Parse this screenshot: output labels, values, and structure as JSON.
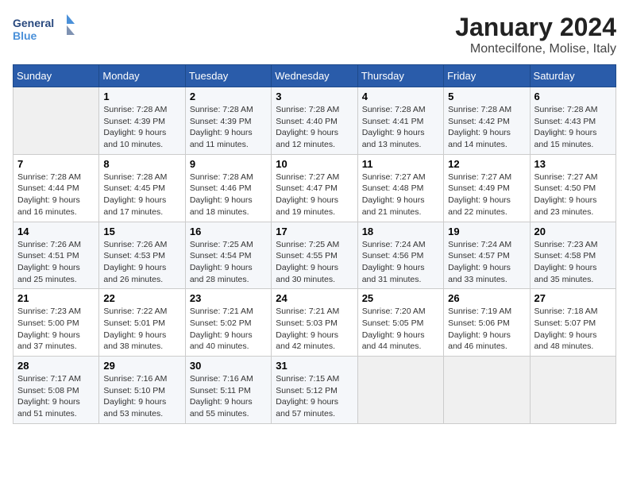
{
  "header": {
    "logo_line1": "General",
    "logo_line2": "Blue",
    "month": "January 2024",
    "location": "Montecilfone, Molise, Italy"
  },
  "days_of_week": [
    "Sunday",
    "Monday",
    "Tuesday",
    "Wednesday",
    "Thursday",
    "Friday",
    "Saturday"
  ],
  "weeks": [
    [
      {
        "num": "",
        "empty": true
      },
      {
        "num": "1",
        "sunrise": "7:28 AM",
        "sunset": "4:39 PM",
        "daylight": "9 hours and 10 minutes."
      },
      {
        "num": "2",
        "sunrise": "7:28 AM",
        "sunset": "4:39 PM",
        "daylight": "9 hours and 11 minutes."
      },
      {
        "num": "3",
        "sunrise": "7:28 AM",
        "sunset": "4:40 PM",
        "daylight": "9 hours and 12 minutes."
      },
      {
        "num": "4",
        "sunrise": "7:28 AM",
        "sunset": "4:41 PM",
        "daylight": "9 hours and 13 minutes."
      },
      {
        "num": "5",
        "sunrise": "7:28 AM",
        "sunset": "4:42 PM",
        "daylight": "9 hours and 14 minutes."
      },
      {
        "num": "6",
        "sunrise": "7:28 AM",
        "sunset": "4:43 PM",
        "daylight": "9 hours and 15 minutes."
      }
    ],
    [
      {
        "num": "7",
        "sunrise": "7:28 AM",
        "sunset": "4:44 PM",
        "daylight": "9 hours and 16 minutes."
      },
      {
        "num": "8",
        "sunrise": "7:28 AM",
        "sunset": "4:45 PM",
        "daylight": "9 hours and 17 minutes."
      },
      {
        "num": "9",
        "sunrise": "7:28 AM",
        "sunset": "4:46 PM",
        "daylight": "9 hours and 18 minutes."
      },
      {
        "num": "10",
        "sunrise": "7:27 AM",
        "sunset": "4:47 PM",
        "daylight": "9 hours and 19 minutes."
      },
      {
        "num": "11",
        "sunrise": "7:27 AM",
        "sunset": "4:48 PM",
        "daylight": "9 hours and 21 minutes."
      },
      {
        "num": "12",
        "sunrise": "7:27 AM",
        "sunset": "4:49 PM",
        "daylight": "9 hours and 22 minutes."
      },
      {
        "num": "13",
        "sunrise": "7:27 AM",
        "sunset": "4:50 PM",
        "daylight": "9 hours and 23 minutes."
      }
    ],
    [
      {
        "num": "14",
        "sunrise": "7:26 AM",
        "sunset": "4:51 PM",
        "daylight": "9 hours and 25 minutes."
      },
      {
        "num": "15",
        "sunrise": "7:26 AM",
        "sunset": "4:53 PM",
        "daylight": "9 hours and 26 minutes."
      },
      {
        "num": "16",
        "sunrise": "7:25 AM",
        "sunset": "4:54 PM",
        "daylight": "9 hours and 28 minutes."
      },
      {
        "num": "17",
        "sunrise": "7:25 AM",
        "sunset": "4:55 PM",
        "daylight": "9 hours and 30 minutes."
      },
      {
        "num": "18",
        "sunrise": "7:24 AM",
        "sunset": "4:56 PM",
        "daylight": "9 hours and 31 minutes."
      },
      {
        "num": "19",
        "sunrise": "7:24 AM",
        "sunset": "4:57 PM",
        "daylight": "9 hours and 33 minutes."
      },
      {
        "num": "20",
        "sunrise": "7:23 AM",
        "sunset": "4:58 PM",
        "daylight": "9 hours and 35 minutes."
      }
    ],
    [
      {
        "num": "21",
        "sunrise": "7:23 AM",
        "sunset": "5:00 PM",
        "daylight": "9 hours and 37 minutes."
      },
      {
        "num": "22",
        "sunrise": "7:22 AM",
        "sunset": "5:01 PM",
        "daylight": "9 hours and 38 minutes."
      },
      {
        "num": "23",
        "sunrise": "7:21 AM",
        "sunset": "5:02 PM",
        "daylight": "9 hours and 40 minutes."
      },
      {
        "num": "24",
        "sunrise": "7:21 AM",
        "sunset": "5:03 PM",
        "daylight": "9 hours and 42 minutes."
      },
      {
        "num": "25",
        "sunrise": "7:20 AM",
        "sunset": "5:05 PM",
        "daylight": "9 hours and 44 minutes."
      },
      {
        "num": "26",
        "sunrise": "7:19 AM",
        "sunset": "5:06 PM",
        "daylight": "9 hours and 46 minutes."
      },
      {
        "num": "27",
        "sunrise": "7:18 AM",
        "sunset": "5:07 PM",
        "daylight": "9 hours and 48 minutes."
      }
    ],
    [
      {
        "num": "28",
        "sunrise": "7:17 AM",
        "sunset": "5:08 PM",
        "daylight": "9 hours and 51 minutes."
      },
      {
        "num": "29",
        "sunrise": "7:16 AM",
        "sunset": "5:10 PM",
        "daylight": "9 hours and 53 minutes."
      },
      {
        "num": "30",
        "sunrise": "7:16 AM",
        "sunset": "5:11 PM",
        "daylight": "9 hours and 55 minutes."
      },
      {
        "num": "31",
        "sunrise": "7:15 AM",
        "sunset": "5:12 PM",
        "daylight": "9 hours and 57 minutes."
      },
      {
        "num": "",
        "empty": true
      },
      {
        "num": "",
        "empty": true
      },
      {
        "num": "",
        "empty": true
      }
    ]
  ],
  "labels": {
    "sunrise": "Sunrise:",
    "sunset": "Sunset:",
    "daylight": "Daylight:"
  }
}
